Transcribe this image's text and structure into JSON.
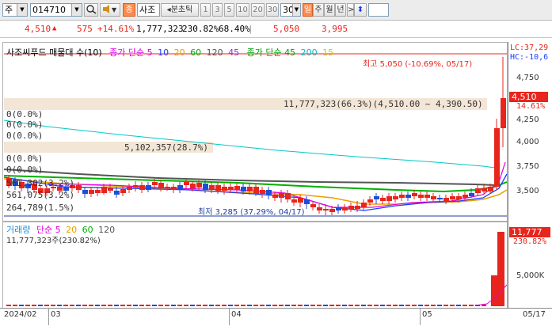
{
  "toolbar": {
    "market_select": "주",
    "code_input": "014710",
    "name_label": "사조",
    "mode_label": "분초틱",
    "periods": [
      "1",
      "3",
      "5",
      "10",
      "20",
      "30"
    ],
    "count_select": "30",
    "day_btn": "일",
    "week_btn": "주",
    "month_btn": "월",
    "year_btn": "년",
    "next_arrow": ">",
    "updown_icon": "updown-arrow-icon",
    "search_icon": "magnifier-icon",
    "sound_icon": "speaker-icon",
    "favorite_icon": "favorite-icon"
  },
  "infobar": {
    "price": "4,510",
    "change": "575",
    "change_pct": "+14.61%",
    "volume": "1,777,323",
    "volume_pct": "230.82%",
    "ratio": "68.40%",
    "high": "5,050",
    "low": "3,995"
  },
  "price_panel": {
    "legend": {
      "title": "사조씨푸드 매물대 수(10)",
      "ma_label": "종가 단순 5",
      "ma_periods": [
        "10",
        "20",
        "60",
        "120"
      ],
      "ma_45": "45",
      "ma2_label": "종가 단순 45",
      "ma2_periods": [
        "200",
        "15"
      ]
    },
    "annotations": {
      "high": "최고 5,050 (-10.69%, 05/17)",
      "low": "최저 3,285 (37.29%, 04/17)",
      "lc": "LC:37,29",
      "hc": "HC:-10,6",
      "current_price": "4,510",
      "current_pct": "14.61%"
    },
    "profile_labels": [
      "0(0.0%)",
      "0(0.0%)",
      "0(0.0%)",
      "0(0.0%)",
      "0(0.0%)",
      "11,777,323(66.3%)(4,510.00 ~ 4,390.50)",
      "5,102,357(28.7%)",
      "561,302(3.2%)",
      "561,075(3.2%)",
      "264,789(1.5%)"
    ],
    "y_ticks": [
      "4,750",
      "4,500",
      "4,250",
      "4,000",
      "3,750",
      "3,500"
    ],
    "y_range": [
      3250,
      5100
    ]
  },
  "volume_panel": {
    "legend": {
      "title": "거래량",
      "ma_label": "단순 5",
      "periods": [
        "20",
        "60",
        "120"
      ]
    },
    "volume_text": "11,777,323주(230.82%)",
    "current_volume": "11,777",
    "current_pct": "230.82%",
    "y_ticks": [
      "5,000K"
    ]
  },
  "x_axis": {
    "labels": [
      "2024/02",
      "03",
      "04",
      "05",
      "05/17"
    ]
  },
  "colors": {
    "up": "#e8251c",
    "down": "#1c4fd8",
    "ma5": "#e000e0",
    "ma10": "#1a3cff",
    "ma20": "#e8a000",
    "ma60": "#00b000",
    "ma120": "#555555",
    "ma45": "#8a2be2",
    "ma200": "#00c8c8",
    "ma15": "#d6d600"
  },
  "chart_data": {
    "type": "candlestick",
    "title": "사조씨푸드",
    "y_range": [
      3250,
      5100
    ],
    "high": {
      "value": 5050,
      "date": "05/17"
    },
    "low": {
      "value": 3285,
      "date": "04/17"
    },
    "current": 4510,
    "volume_last": 11777323
  }
}
